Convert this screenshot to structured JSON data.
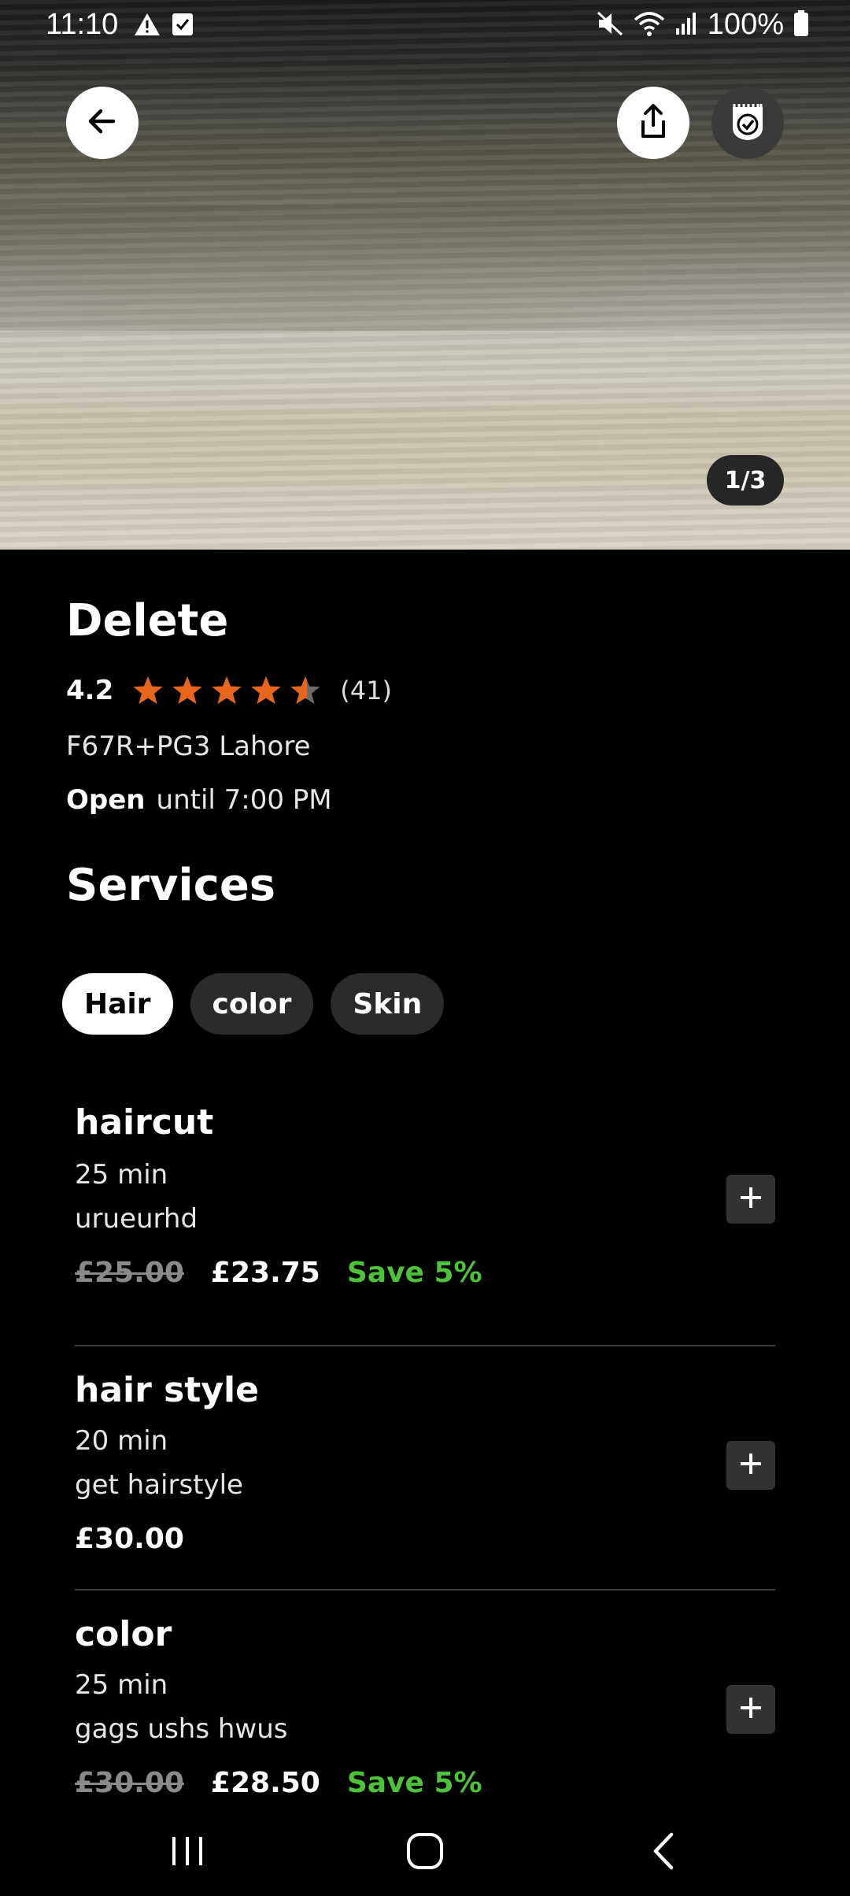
{
  "status_bar": {
    "time": "11:10",
    "battery": "100%",
    "left_icons": [
      "warning-icon",
      "checkbox-icon"
    ],
    "right_icons": [
      "mute-icon",
      "wifi-icon",
      "signal-icon",
      "battery-icon"
    ]
  },
  "hero": {
    "image_counter": "1/3"
  },
  "shop": {
    "name": "Delete",
    "rating": "4.2",
    "rating_stars": 4.2,
    "rating_count": "(41)",
    "address": "F67R+PG3 Lahore",
    "open_label": "Open",
    "hours": "until 7:00 PM"
  },
  "services": {
    "title": "Services",
    "categories": [
      {
        "label": "Hair",
        "active": true
      },
      {
        "label": "color",
        "active": false
      },
      {
        "label": "Skin",
        "active": false
      }
    ],
    "items": [
      {
        "name": "haircut",
        "duration": "25 min",
        "description": "urueurhd",
        "old_price": "£25.00",
        "price": "£23.75",
        "save": "Save 5%"
      },
      {
        "name": "hair style",
        "duration": "20 min",
        "description": "get hairstyle",
        "old_price": "",
        "price": "£30.00",
        "save": ""
      },
      {
        "name": "color",
        "duration": "25 min",
        "description": "gags ushs hwus",
        "old_price": "£30.00",
        "price": "£28.50",
        "save": "Save 5%"
      }
    ]
  },
  "colors": {
    "background": "#000000",
    "star": "#e8651c",
    "save": "#4ec23a",
    "chip_active": "#ffffff",
    "chip_inactive": "#2b2b2b"
  }
}
